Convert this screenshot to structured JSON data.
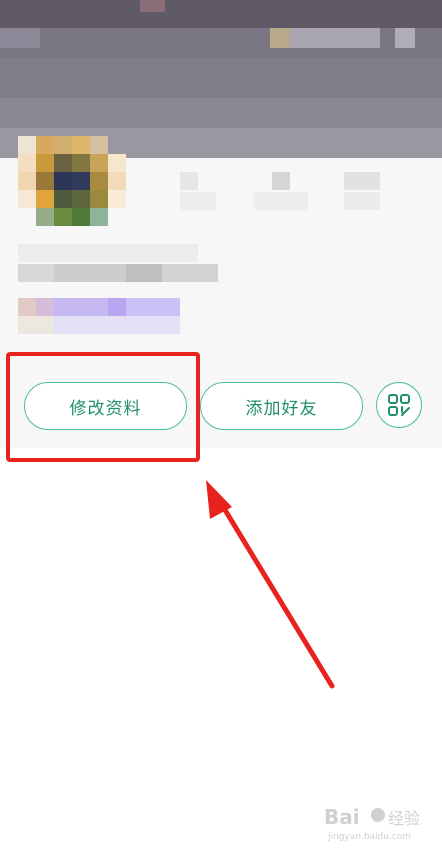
{
  "profile": {
    "edit_button_label": "修改资料",
    "add_friend_button_label": "添加好友"
  },
  "colors": {
    "accent": "#4cbe96",
    "accent_text": "#1f8f66",
    "annotation": "#e8221c"
  },
  "icons": {
    "qr": "qr-code-icon"
  }
}
